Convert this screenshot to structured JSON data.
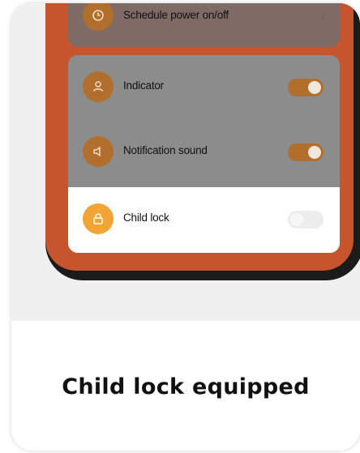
{
  "settings": {
    "schedule": {
      "label": "Schedule power on/off",
      "icon": "clock-icon"
    },
    "indicator": {
      "label": "Indicator",
      "icon": "person-icon",
      "toggle_on": true
    },
    "notification": {
      "label": "Notification sound",
      "icon": "speaker-icon",
      "toggle_on": true
    },
    "child_lock": {
      "label": "Child lock",
      "icon": "lock-icon",
      "toggle_on": false
    }
  },
  "caption": "Child lock equipped",
  "colors": {
    "accent": "#f2a535",
    "accent_dimmed": "#b26e2c",
    "phone_frame": "#c6552e"
  }
}
